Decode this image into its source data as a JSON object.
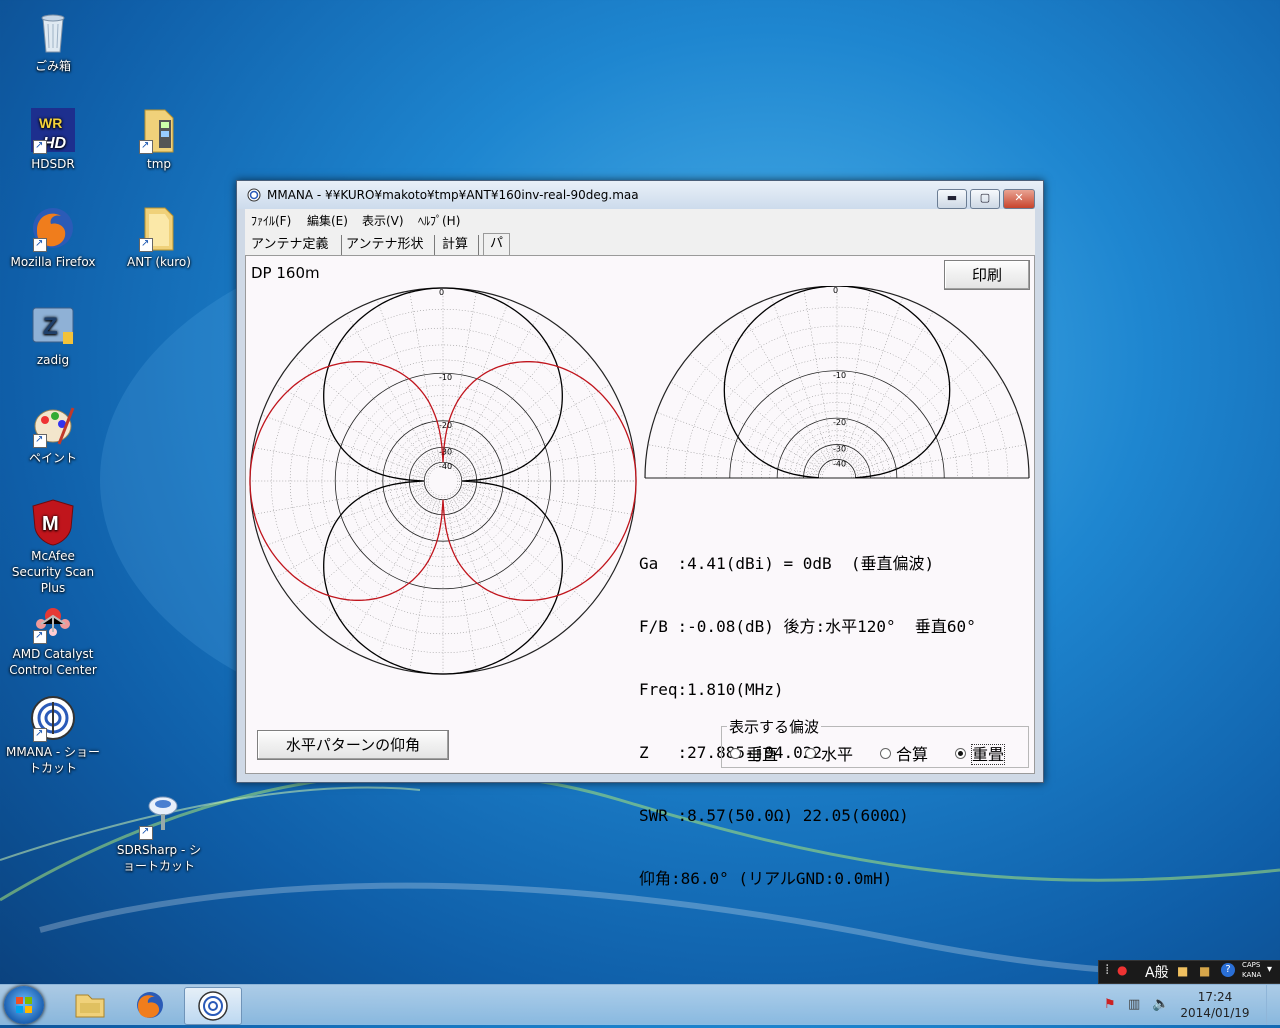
{
  "desktop": {
    "icons": [
      {
        "label": "ごみ箱"
      },
      {
        "label": "HDSDR"
      },
      {
        "label": "tmp"
      },
      {
        "label": "Mozilla Firefox"
      },
      {
        "label": "ANT (kuro)"
      },
      {
        "label": "zadig"
      },
      {
        "label": "ペイント"
      },
      {
        "label": "McAfee Security Scan Plus"
      },
      {
        "label": "AMD Catalyst Control Center"
      },
      {
        "label": "MMANA - ショートカット"
      },
      {
        "label": "SDRSharp - ショートカット"
      }
    ]
  },
  "window": {
    "title": "MMANA - ¥¥KURO¥makoto¥tmp¥ANT¥160inv-real-90deg.maa",
    "controls": {
      "minimize": "▬",
      "maximize": "▢",
      "close": "✕"
    },
    "menu": {
      "file": "ﾌｧｲﾙ(F)",
      "edit": "編集(E)",
      "view": "表示(V)",
      "help": "ﾍﾙﾌﾟ(H)"
    },
    "tabs": [
      "アンテナ定義",
      "アンテナ形状",
      "計算",
      "パターン"
    ],
    "active_tab": "パターン"
  },
  "pattern": {
    "dp_label": "DP 160m",
    "print_button": "印刷",
    "elevation_button": "水平パターンの仰角",
    "db_labels": [
      "0",
      "-10",
      "-20",
      "-30",
      "-40"
    ],
    "colors": {
      "vertical_pattern": "#000000",
      "horizontal_pattern": "#c0141c",
      "grid": "#7a7a7a"
    },
    "info": {
      "ga": "Ga  :4.41(dBi) = 0dB  (垂直偏波)",
      "fb": "F/B :-0.08(dB) 後方:水平120°  垂直60°",
      "freq": "Freq:1.810(MHz)",
      "z": "Z   :27.885-j94.022",
      "swr": "SWR :8.57(50.0Ω) 22.05(600Ω)",
      "elev": "仰角:86.0° (リアルGND:0.0mH)"
    },
    "polarization": {
      "legend": "表示する偏波",
      "options": [
        "垂直",
        "水平",
        "合算",
        "重畳"
      ],
      "selected": "重畳"
    }
  },
  "taskbar": {
    "language_bar": "A般",
    "caps": "CAPS",
    "kana": "KANA",
    "time": "17:24",
    "date": "2014/01/19"
  }
}
